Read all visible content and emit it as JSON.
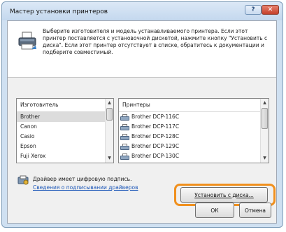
{
  "window": {
    "title": "Мастер установки принтеров",
    "help_label": "?",
    "close_label": "✕"
  },
  "intro": {
    "text": "Выберите изготовителя и модель устанавливаемого принтера. Если этот принтер поставляется с установочной дискетой, нажмите кнопку \"Установить с диска\". Если этот принтер отсутствует в списке, обратитесь к документации и подберите совместимый."
  },
  "manufacturers": {
    "header": "Изготовитель",
    "items": [
      "Brother",
      "Canon",
      "Casio",
      "Epson",
      "Fuji Xerox"
    ],
    "selected_index": 0
  },
  "printers": {
    "header": "Принтеры",
    "items": [
      "Brother DCP-116C",
      "Brother DCP-117C",
      "Brother DCP-128C",
      "Brother DCP-129C",
      "Brother DCP-130C"
    ]
  },
  "signature": {
    "text": "Драйвер имеет цифровую подпись.",
    "link": "Сведения о подписывании драйверов"
  },
  "buttons": {
    "have_disk": "Установить с диска...",
    "ok": "ОК",
    "cancel": "Отмена"
  },
  "colors": {
    "highlight": "#f0901e",
    "link": "#1c57b8",
    "close_button": "#c4402b"
  },
  "icons": {
    "wizard": "printer-wizard-icon",
    "signature": "certified-driver-icon",
    "printer_item": "printer-icon"
  }
}
